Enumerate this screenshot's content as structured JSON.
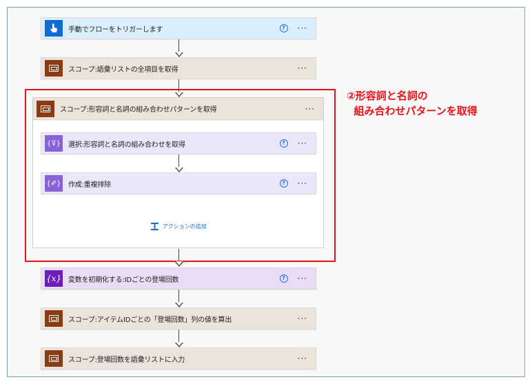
{
  "flow": {
    "trigger": {
      "label": "手動でフローをトリガーします",
      "help": "?",
      "more": "···",
      "icon": "touch-hand-icon"
    },
    "scope1": {
      "label": "スコープ:語彙リストの全項目を取得",
      "more": "···",
      "icon": "scope-icon"
    },
    "scope2": {
      "label": "スコープ:形容詞と名詞の組み合わせパターンを取得",
      "more": "···",
      "icon": "scope-icon",
      "actions": [
        {
          "label": "選択:形容詞と名詞の組み合わせを取得",
          "help": "?",
          "more": "···",
          "icon": "select-braces-icon",
          "icon_text": "{⊽}"
        },
        {
          "label": "作成:重複排除",
          "help": "?",
          "more": "···",
          "icon": "compose-braces-icon",
          "icon_text": "{✐}"
        }
      ],
      "add_action": "アクションの追加"
    },
    "variable": {
      "label": "変数を初期化する:IDごとの登場回数",
      "help": "?",
      "more": "···",
      "icon": "variable-icon",
      "icon_text": "{𝑥}"
    },
    "scope3": {
      "label": "スコープ:アイテムIDごとの「登場回数」列の値を算出",
      "more": "···",
      "icon": "scope-icon"
    },
    "scope4": {
      "label": "スコープ:登場回数を語彙リストに入力",
      "more": "···",
      "icon": "scope-icon"
    }
  },
  "annotation": {
    "text": "②形容詞と名詞の\n  組み合わせパターンを取得",
    "color": "#e8121b"
  },
  "colors": {
    "trigger": "#0f6cd4",
    "scope": "#8a3b12",
    "operation": "#8863d8",
    "variable": "#6c1fb8",
    "highlight": "#e8121b",
    "link": "#1a6fd1"
  }
}
